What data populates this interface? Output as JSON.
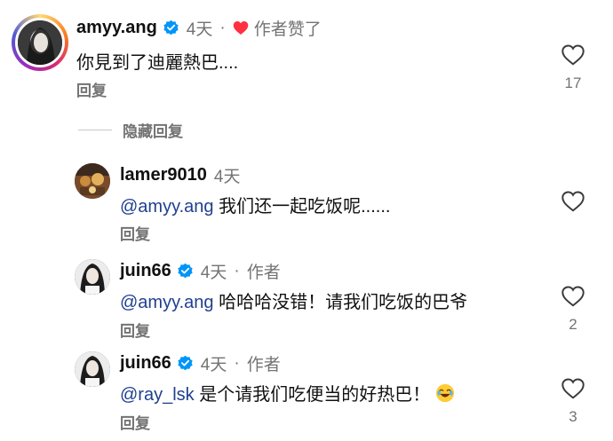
{
  "comments": [
    {
      "username": "amyy.ang",
      "time": "4天",
      "separator": "·",
      "author_liked": "作者赞了",
      "text": "你見到了迪麗熱巴....",
      "reply_label": "回复",
      "like_count": "17"
    }
  ],
  "hide_replies_label": "隐藏回复",
  "replies": [
    {
      "username": "lamer9010",
      "time": "4天",
      "mention": "@amyy.ang",
      "text": " 我们还一起吃饭呢......",
      "reply_label": "回复",
      "like_count": ""
    },
    {
      "username": "juin66",
      "time": "4天",
      "separator": "·",
      "author_tag": "作者",
      "mention": "@amyy.ang",
      "text": " 哈哈哈没错！请我们吃饭的巴爷",
      "reply_label": "回复",
      "like_count": "2"
    },
    {
      "username": "juin66",
      "time": "4天",
      "separator": "·",
      "author_tag": "作者",
      "mention": "@ray_lsk",
      "text": " 是个请我们吃便当的好热巴！",
      "reply_label": "回复",
      "like_count": "3"
    }
  ],
  "colors": {
    "verified_blue": "#0095f6",
    "heart_red": "#ff3040",
    "mention_blue": "#1f3f8f",
    "secondary_gray": "#737373"
  },
  "icons": [
    "verified-badge-icon",
    "heart-icon",
    "heart-outline-icon",
    "laughing-emoji-icon"
  ]
}
